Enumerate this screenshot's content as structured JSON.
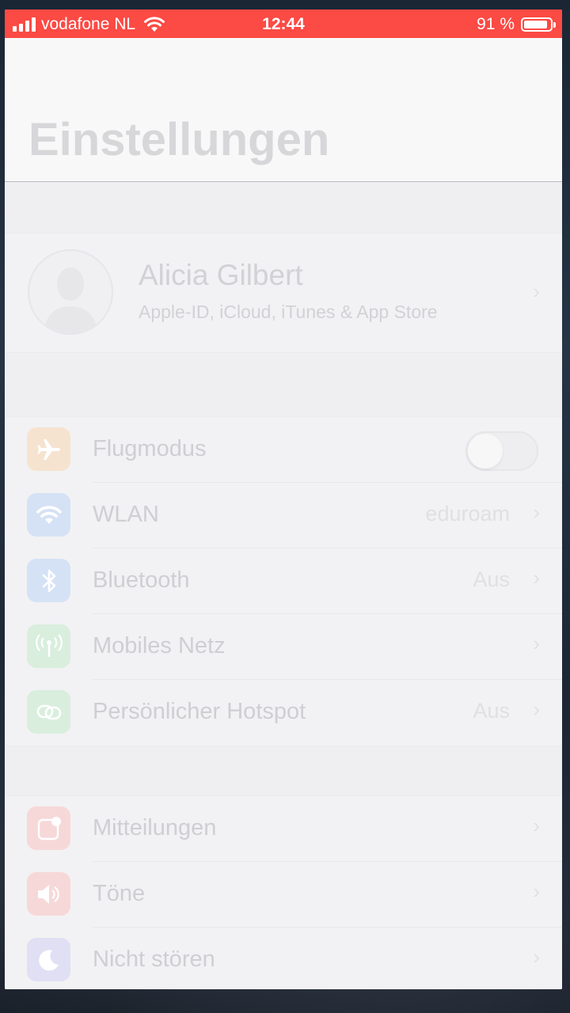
{
  "status_bar": {
    "carrier": "vodafone NL",
    "time": "12:44",
    "battery": "91 %",
    "battery_level": 0.91,
    "bar_color": "#fc4a44"
  },
  "header": {
    "title": "Einstellungen"
  },
  "profile": {
    "name": "Alicia Gilbert",
    "subtitle": "Apple-ID, iCloud, iTunes & App Store"
  },
  "group1": [
    {
      "label": "Flugmodus",
      "icon": "airplane-icon",
      "color": "#f6e3cf",
      "toggle_on": false
    },
    {
      "label": "WLAN",
      "value": "eduroam",
      "icon": "wifi-icon",
      "color": "#d5e2f5"
    },
    {
      "label": "Bluetooth",
      "value": "Aus",
      "icon": "bluetooth-icon",
      "color": "#d5e2f5"
    },
    {
      "label": "Mobiles Netz",
      "icon": "antenna-icon",
      "color": "#d9eedd"
    },
    {
      "label": "Persönlicher Hotspot",
      "value": "Aus",
      "icon": "hotspot-icon",
      "color": "#d9eedd"
    }
  ],
  "group2": [
    {
      "label": "Mitteilungen",
      "icon": "notifications-icon",
      "color": "#f7d8d8"
    },
    {
      "label": "Töne",
      "icon": "speaker-icon",
      "color": "#f7d8d8"
    },
    {
      "label": "Nicht stören",
      "icon": "moon-icon",
      "color": "#e1dff4"
    }
  ]
}
